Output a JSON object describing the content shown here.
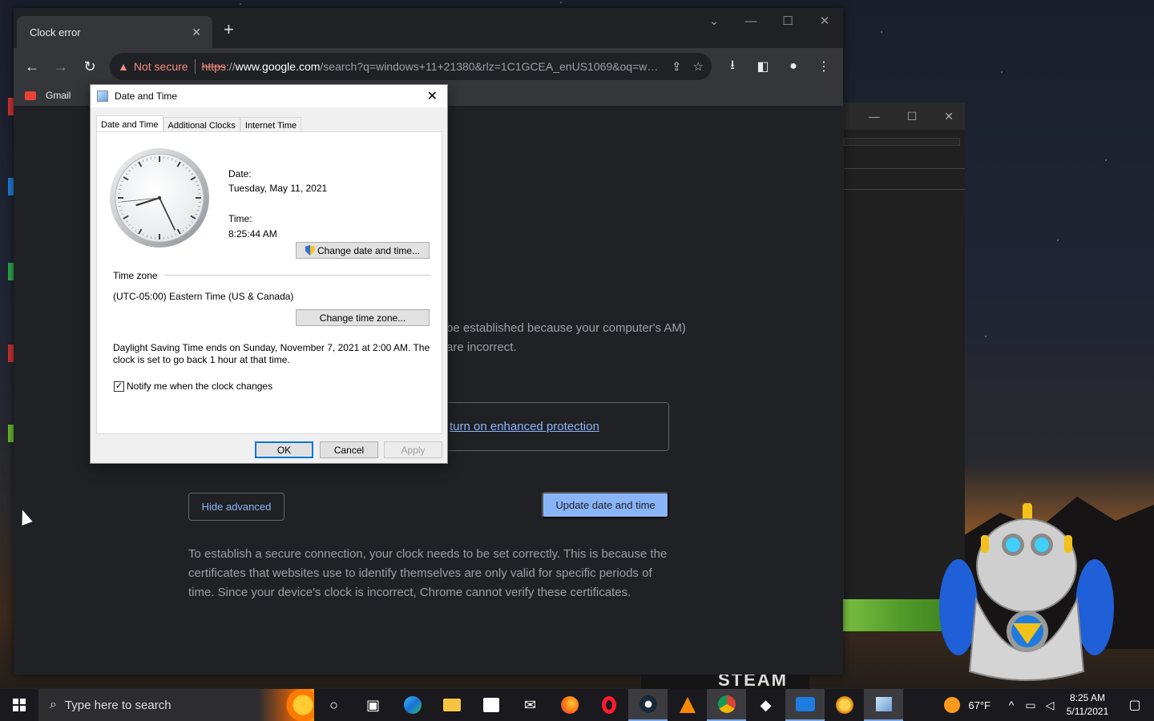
{
  "browser": {
    "tab_title": "Clock error",
    "omnibox": {
      "security_label": "Not secure",
      "scheme": "https",
      "scheme_sep": "://",
      "host": "www.google.com",
      "path": "/search?q=windows+11+21380&rlz=1C1GCEA_enUS1069&oq=windo..."
    },
    "bookmarks": [
      {
        "label": "Gmail"
      }
    ]
  },
  "page": {
    "text_partial": "be established because your computer's AM) are incorrect.",
    "enhanced_protection_link": "turn on enhanced protection",
    "hide_advanced_label": "Hide advanced",
    "update_button_label": "Update date and time",
    "explanation": "To establish a secure connection, your clock needs to be set correctly. This is because the certificates that websites use to identify themselves are only valid for specific periods of time. Since your device's clock is incorrect, Chrome cannot verify these certificates."
  },
  "dialog": {
    "title": "Date and Time",
    "tabs": [
      {
        "label": "Date and Time",
        "active": true
      },
      {
        "label": "Additional Clocks",
        "active": false
      },
      {
        "label": "Internet Time",
        "active": false
      }
    ],
    "date_label": "Date:",
    "date_value": "Tuesday, May 11, 2021",
    "time_label": "Time:",
    "time_value": "8:25:44 AM",
    "clock": {
      "hour": 8,
      "minute": 25,
      "second": 44
    },
    "change_datetime_label": "Change date and time...",
    "timezone_heading": "Time zone",
    "timezone_value": "(UTC-05:00) Eastern Time (US & Canada)",
    "change_timezone_label": "Change time zone...",
    "dst_note": "Daylight Saving Time ends on Sunday, November 7, 2021 at 2:00 AM. The clock is set to go back 1 hour at that time.",
    "notify_label": "Notify me when the clock changes",
    "notify_checked": true,
    "ok_label": "OK",
    "cancel_label": "Cancel",
    "apply_label": "Apply"
  },
  "desktop": {
    "steam_text": "STEAM"
  },
  "taskbar": {
    "search_placeholder": "Type here to search",
    "weather": "67°F",
    "time": "8:25 AM",
    "date": "5/11/2021"
  },
  "colors": {
    "accent": "#8ab4f8",
    "warning": "#f28b82",
    "chrome_bg": "#202124"
  }
}
